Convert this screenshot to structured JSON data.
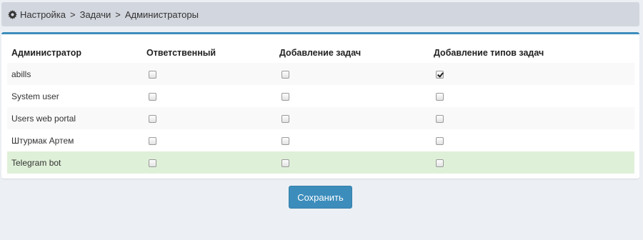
{
  "breadcrumb": {
    "items": [
      "Настройка",
      "Задачи",
      "Администраторы"
    ],
    "separator": ">"
  },
  "table": {
    "headers": [
      "Администратор",
      "Ответственный",
      "Добавление задач",
      "Добавление типов задач"
    ],
    "rows": [
      {
        "name": "abills",
        "responsible": false,
        "add_tasks": false,
        "add_task_types": true
      },
      {
        "name": "System user",
        "responsible": false,
        "add_tasks": false,
        "add_task_types": false
      },
      {
        "name": "Users web portal",
        "responsible": false,
        "add_tasks": false,
        "add_task_types": false
      },
      {
        "name": "Штурмак Артем",
        "responsible": false,
        "add_tasks": false,
        "add_task_types": false
      },
      {
        "name": "Telegram bot",
        "responsible": false,
        "add_tasks": false,
        "add_task_types": false
      }
    ]
  },
  "save_label": "Сохранить",
  "colors": {
    "accent": "#3c8dbc",
    "success_row": "#dff0d8",
    "page_bg": "#ecf0f5"
  }
}
